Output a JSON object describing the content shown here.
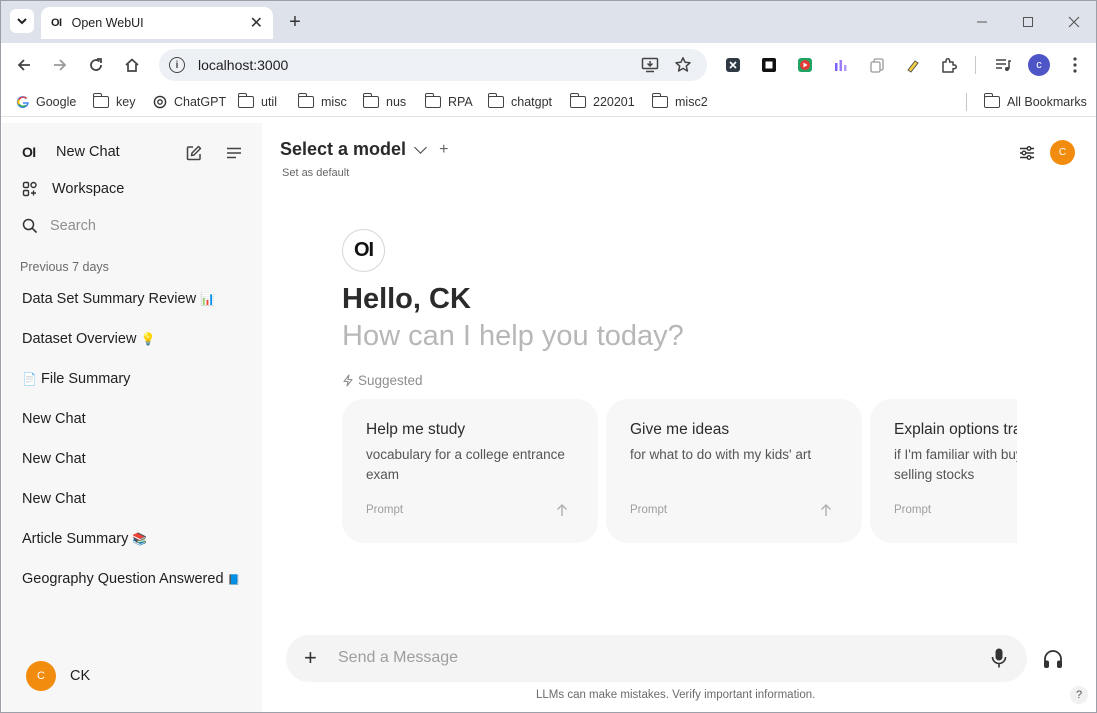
{
  "browser": {
    "tab_title": "Open WebUI",
    "tab_favicon": "OI",
    "url": "localhost:3000",
    "profile_initial": "c",
    "bookmarks": [
      {
        "label": "Google",
        "icon": "google-icon"
      },
      {
        "label": "key",
        "icon": "folder-icon"
      },
      {
        "label": "ChatGPT",
        "icon": "chatgpt-icon"
      },
      {
        "label": "util",
        "icon": "folder-icon"
      },
      {
        "label": "misc",
        "icon": "folder-icon"
      },
      {
        "label": "nus",
        "icon": "folder-icon"
      },
      {
        "label": "RPA",
        "icon": "folder-icon"
      },
      {
        "label": "chatgpt",
        "icon": "folder-icon"
      },
      {
        "label": "220201",
        "icon": "folder-icon"
      },
      {
        "label": "misc2",
        "icon": "folder-icon"
      }
    ],
    "all_bookmarks_label": "All Bookmarks"
  },
  "sidebar": {
    "logo": "OI",
    "new_chat_label": "New Chat",
    "workspace_label": "Workspace",
    "search_placeholder": "Search",
    "section_label": "Previous 7 days",
    "chats": [
      {
        "label": "Data Set Summary Review",
        "emoji": "📊"
      },
      {
        "label": "Dataset Overview",
        "emoji": "💡"
      },
      {
        "label": "File Summary",
        "emoji": "📄",
        "emoji_first": true
      },
      {
        "label": "New Chat",
        "emoji": ""
      },
      {
        "label": "New Chat",
        "emoji": ""
      },
      {
        "label": "New Chat",
        "emoji": ""
      },
      {
        "label": "Article Summary",
        "emoji": "📚"
      },
      {
        "label": "Geography Question Answered",
        "emoji": "📘"
      }
    ],
    "user": {
      "avatar_initial": "C",
      "name": "CK"
    }
  },
  "main": {
    "model_select_label": "Select a model",
    "set_default_label": "Set as default",
    "header_avatar_initial": "C",
    "logo": "OI",
    "greeting": "Hello, CK",
    "subtitle": "How can I help you today?",
    "suggested_label": "Suggested",
    "cards": [
      {
        "title": "Help me study",
        "desc": "vocabulary for a college entrance exam",
        "footer": "Prompt"
      },
      {
        "title": "Give me ideas",
        "desc": "for what to do with my kids' art",
        "footer": "Prompt"
      },
      {
        "title": "Explain options trading",
        "desc": "if I'm familiar with buying and selling stocks",
        "footer": "Prompt"
      }
    ],
    "composer_placeholder": "Send a Message",
    "disclaimer": "LLMs can make mistakes. Verify important information.",
    "help_label": "?"
  },
  "colors": {
    "avatar": "#f28c0f",
    "sidebar_bg": "#f7f7f7",
    "card_bg": "#f7f7f7",
    "tabstrip_bg": "#dee3eb"
  }
}
